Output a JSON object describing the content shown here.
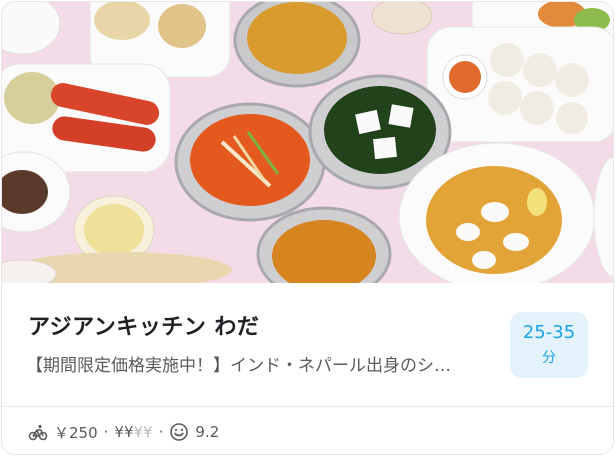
{
  "restaurant": {
    "name": "アジアンキッチン わだ",
    "description": "【期間限定価格実施中！】インド・ネパール出身のシ…",
    "eta": {
      "range": "25-35",
      "unit": "分"
    },
    "meta": {
      "delivery_fee": "￥250",
      "separator": "·",
      "price_level_active": "¥¥",
      "price_level_inactive": "¥¥",
      "rating": "9.2"
    }
  },
  "icons": {
    "delivery": "bicycle-icon",
    "rating": "smiley-face-icon"
  },
  "colors": {
    "accent": "#1aa3e8",
    "eta_background": "#e3f2fb",
    "text_primary": "#202125",
    "text_secondary": "#5b5b5f",
    "hero_background": "#f3dbe7"
  }
}
